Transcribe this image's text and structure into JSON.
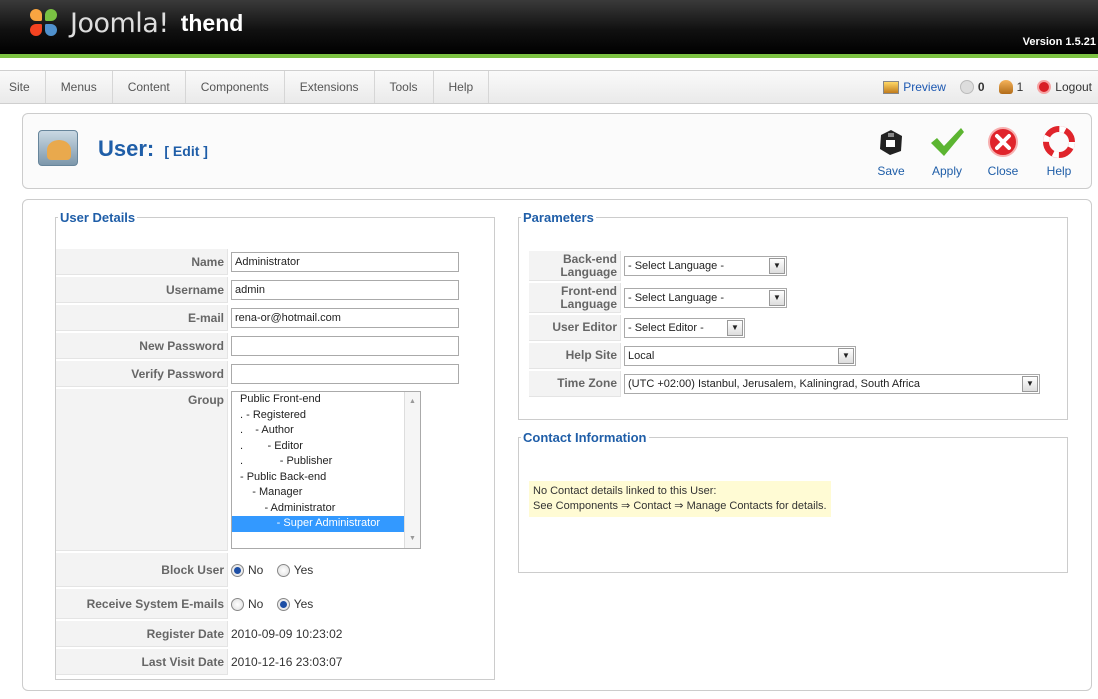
{
  "header": {
    "logo_text": "Joomla!",
    "site_name": "thend",
    "version": "Version 1.5.21"
  },
  "menu": {
    "items": [
      "Site",
      "Menus",
      "Content",
      "Components",
      "Extensions",
      "Tools",
      "Help"
    ]
  },
  "status": {
    "preview": "Preview",
    "messages_count": "0",
    "users_count": "1",
    "logout": "Logout"
  },
  "toolbar": {
    "title": "User:",
    "subtitle": "[ Edit ]",
    "save": "Save",
    "apply": "Apply",
    "close": "Close",
    "help": "Help"
  },
  "user_details": {
    "legend": "User Details",
    "name_label": "Name",
    "name_value": "Administrator",
    "username_label": "Username",
    "username_value": "admin",
    "email_label": "E-mail",
    "email_value": "rena-or@hotmail.com",
    "new_password_label": "New Password",
    "new_password_value": "",
    "verify_password_label": "Verify Password",
    "verify_password_value": "",
    "group_label": "Group",
    "groups": [
      "Public Front-end",
      ". - Registered",
      ".    - Author",
      ".        - Editor",
      ".            - Publisher",
      "- Public Back-end",
      "    - Manager",
      "        - Administrator",
      "            - Super Administrator"
    ],
    "selected_group": "            - Super Administrator",
    "block_user_label": "Block User",
    "block_user_no": "No",
    "block_user_yes": "Yes",
    "block_user_value": "No",
    "receive_emails_label": "Receive System E-mails",
    "receive_emails_no": "No",
    "receive_emails_yes": "Yes",
    "receive_emails_value": "Yes",
    "register_date_label": "Register Date",
    "register_date_value": "2010-09-09 10:23:02",
    "last_visit_label": "Last Visit Date",
    "last_visit_value": "2010-12-16 23:03:07"
  },
  "parameters": {
    "legend": "Parameters",
    "backend_lang_label": "Back-end Language",
    "backend_lang_value": "- Select Language -",
    "frontend_lang_label": "Front-end Language",
    "frontend_lang_value": "- Select Language -",
    "editor_label": "User Editor",
    "editor_value": "- Select Editor -",
    "help_site_label": "Help Site",
    "help_site_value": "Local",
    "timezone_label": "Time Zone",
    "timezone_value": "(UTC +02:00) Istanbul, Jerusalem, Kaliningrad, South Africa"
  },
  "contact": {
    "legend": "Contact Information",
    "line1": "No Contact details linked to this User:",
    "line2": "See Components ⇒ Contact ⇒  Manage Contacts for details."
  },
  "colors": {
    "accent_blue": "#1f5ea8",
    "header_green": "#7cc242",
    "selection_blue": "#3399ff",
    "note_yellow": "#fffbd4"
  }
}
